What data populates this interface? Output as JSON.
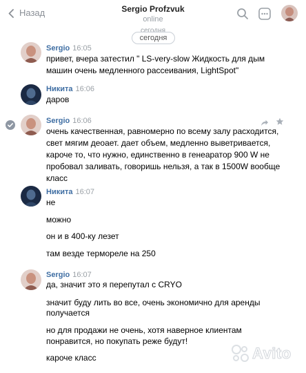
{
  "header": {
    "back_label": "Назад",
    "title": "Sergio Profzvuk",
    "status": "online"
  },
  "date_ghost": "сегодня",
  "date_pill": "сегодня",
  "messages": [
    {
      "author": "Sergio",
      "time": "16:05",
      "lines": [
        "привет, вчера затестил \" LS-very-slow Жидкость для дым",
        "машин очень медленного рассеивания, LightSpot\""
      ]
    },
    {
      "author": "Никита",
      "time": "16:06",
      "lines": [
        "даров"
      ]
    },
    {
      "author": "Sergio",
      "time": "16:06",
      "lines": [
        "очень качественная, равномерно по всему залу расходится,",
        "свет мягим деоает. дает объем, медленно выветривается,",
        "кароче то, что нужно, единственно в генеаратор 900 W не",
        "пробовал заливать, говоришь нельзя, а так в 1500W вообще",
        "класс"
      ]
    },
    {
      "author": "Никита",
      "time": "16:07",
      "lines": [
        "не",
        "можно",
        "он и в 400-ку лезет",
        "там везде термореле на 250"
      ]
    },
    {
      "author": "Sergio",
      "time": "16:07",
      "lines": [
        "да, значит это я перепутал с CRYO",
        "значит буду лить во все, очень экономично для аренды",
        "получается",
        "но для продажи не очень, хотя наверное клиентам",
        "понравится, но покупать реже будут!",
        "кароче класс"
      ]
    }
  ],
  "watermark": "Avito",
  "icons": {
    "back": "chevron-left-icon",
    "search": "search-icon",
    "more": "more-icon",
    "check": "check-circle-icon",
    "share": "share-arrow-icon",
    "star": "star-icon"
  },
  "colors": {
    "author_name": "#3f6ea3",
    "muted": "#9aa0a6",
    "check": "#8e97a3"
  }
}
